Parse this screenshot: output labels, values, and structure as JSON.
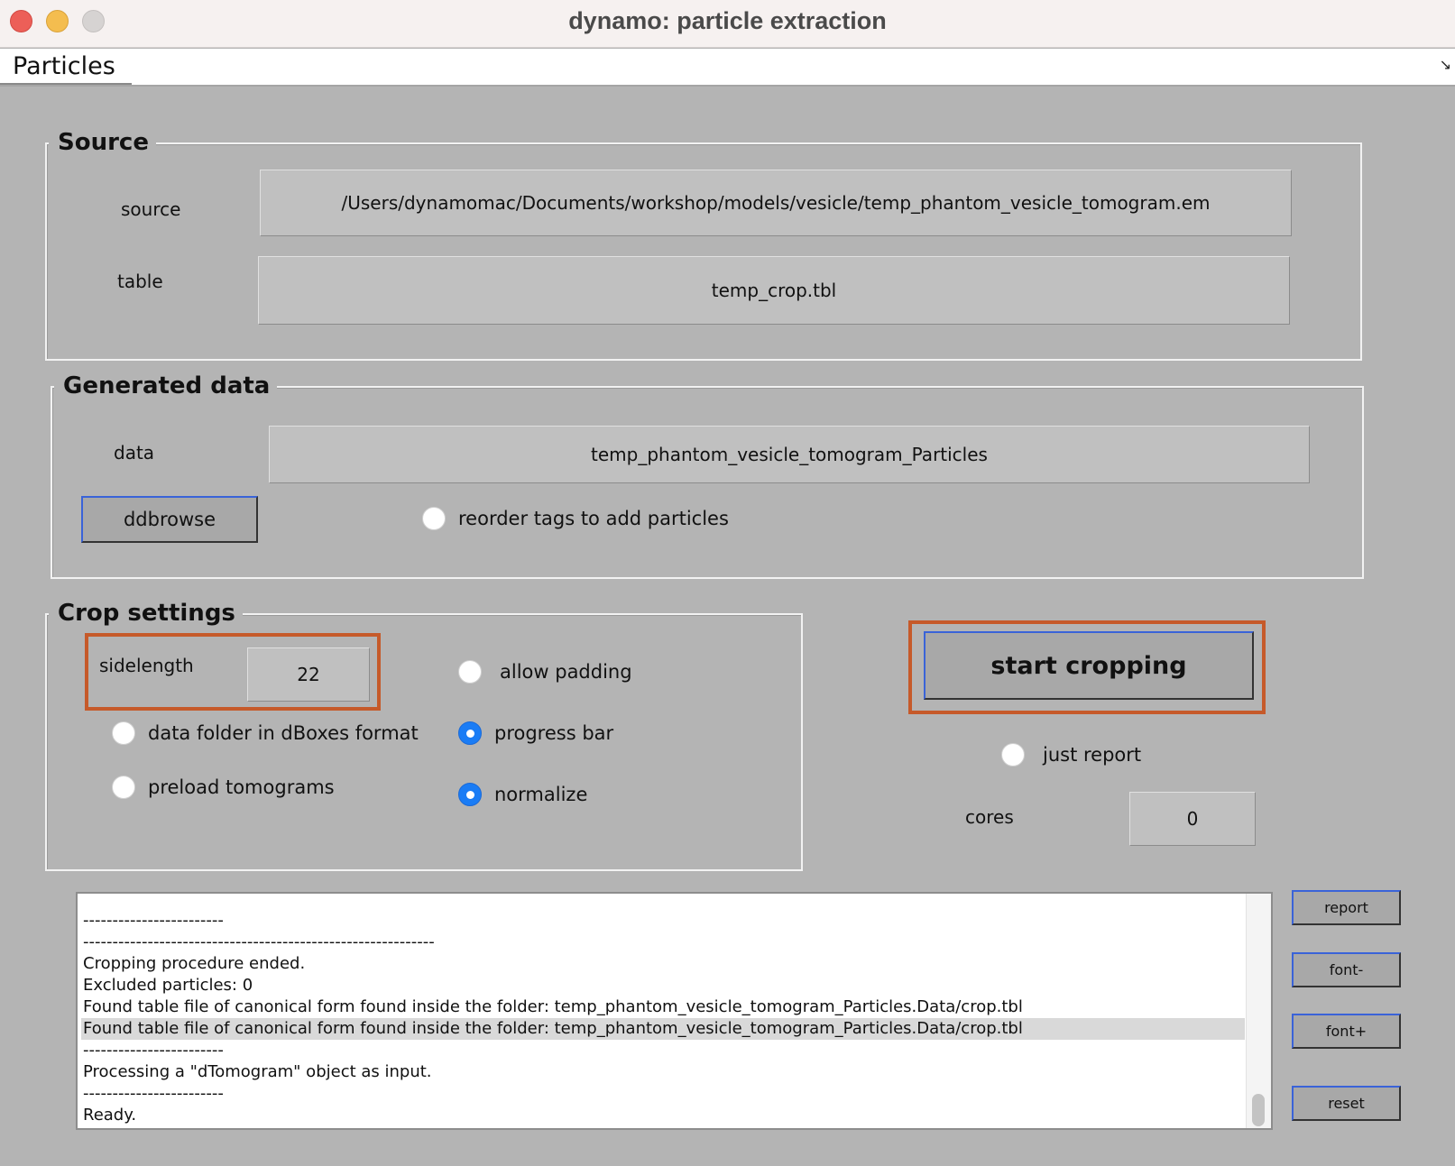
{
  "window": {
    "title": "dynamo: particle extraction"
  },
  "menu": {
    "items": [
      "Particles"
    ],
    "overflow_icon": "corner-arrow-icon"
  },
  "source": {
    "title": "Source",
    "source_label": "source",
    "source_value": "/Users/dynamomac/Documents/workshop/models/vesicle/temp_phantom_vesicle_tomogram.em",
    "table_label": "table",
    "table_value": "temp_crop.tbl"
  },
  "generated": {
    "title": "Generated data",
    "data_label": "data",
    "data_value": "temp_phantom_vesicle_tomogram_Particles",
    "ddbrowse_label": "ddbrowse",
    "reorder_label": "reorder tags to add particles",
    "reorder_on": false
  },
  "crop": {
    "title": "Crop settings",
    "sidelength_label": "sidelength",
    "sidelength_value": "22",
    "allow_padding_label": "allow padding",
    "dboxes_label": "data folder in dBoxes format",
    "progress_bar_label": "progress bar",
    "preload_label": "preload tomograms",
    "normalize_label": "normalize"
  },
  "run": {
    "start_label": "start cropping",
    "just_report_label": "just report",
    "cores_label": "cores",
    "cores_value": "0"
  },
  "log": {
    "lines": [
      "------------------------",
      "------------------------------------------------------------",
      "Cropping procedure ended.",
      "Excluded particles: 0",
      "Found table file of canonical form found inside the folder: temp_phantom_vesicle_tomogram_Particles.Data/crop.tbl",
      "Found table file of canonical form found inside the folder: temp_phantom_vesicle_tomogram_Particles.Data/crop.tbl",
      "------------------------",
      "Processing a \"dTomogram\" object as input.",
      "------------------------",
      "Ready."
    ],
    "selected_index": 5
  },
  "side_buttons": {
    "report": "report",
    "font_minus": "font-",
    "font_plus": "font+",
    "reset": "reset"
  },
  "colors": {
    "highlight": "#c65a2a",
    "radio_on": "#1a7cf5",
    "button_focus_edge": "#3a63d8",
    "background": "#b4b4b4"
  }
}
